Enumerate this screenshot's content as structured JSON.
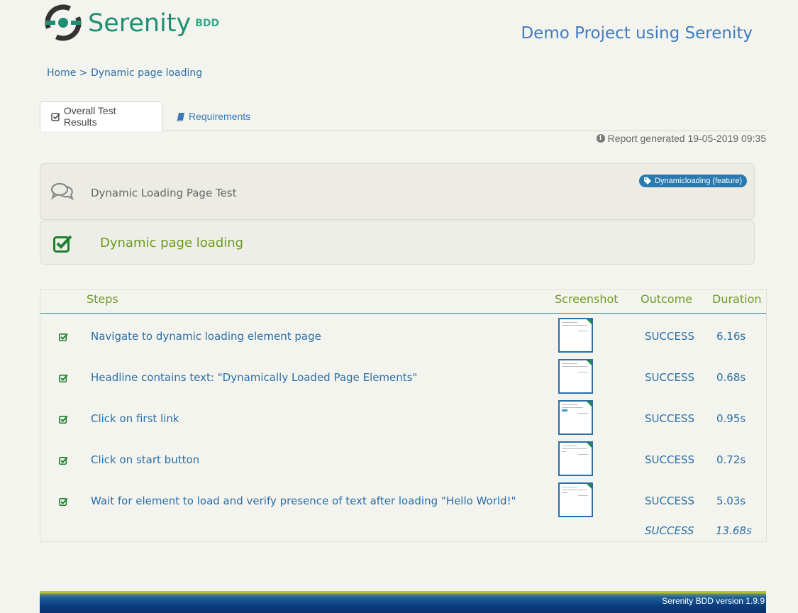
{
  "header": {
    "logo_text": "Serenity",
    "logo_badge": "BDD",
    "project_title": "Demo Project using Serenity"
  },
  "breadcrumb": {
    "home": "Home",
    "separator": ">",
    "current": "Dynamic page loading"
  },
  "tabs": [
    {
      "label": "Overall Test Results",
      "icon": "check-square-icon",
      "active": true
    },
    {
      "label": "Requirements",
      "icon": "book-icon",
      "active": false
    }
  ],
  "report_generated": "Report generated 19-05-2019 09:35",
  "feature": {
    "title": "Dynamic Loading Page Test",
    "tag": "Dynamicloading (feature)"
  },
  "scenario": {
    "title": "Dynamic page loading"
  },
  "steps_table": {
    "headers": {
      "steps": "Steps",
      "screenshot": "Screenshot",
      "outcome": "Outcome",
      "duration": "Duration"
    },
    "rows": [
      {
        "description": "Navigate to dynamic loading element page",
        "outcome": "SUCCESS",
        "duration": "6.16s"
      },
      {
        "description": "Headline contains text: \"Dynamically Loaded Page Elements\"",
        "outcome": "SUCCESS",
        "duration": "0.68s"
      },
      {
        "description": "Click on first link",
        "outcome": "SUCCESS",
        "duration": "0.95s"
      },
      {
        "description": "Click on start button",
        "outcome": "SUCCESS",
        "duration": "0.72s"
      },
      {
        "description": "Wait for element to load and verify presence of text after loading \"Hello World!\"",
        "outcome": "SUCCESS",
        "duration": "5.03s"
      }
    ],
    "total": {
      "outcome": "SUCCESS",
      "duration": "13.68s"
    }
  },
  "footer": {
    "version": "Serenity BDD version 1.9.9"
  },
  "colors": {
    "brand_green": "#1f8f74",
    "link_blue": "#2a6fa8",
    "success_green": "#6a9a1a",
    "tag_blue": "#2a7ab0"
  }
}
